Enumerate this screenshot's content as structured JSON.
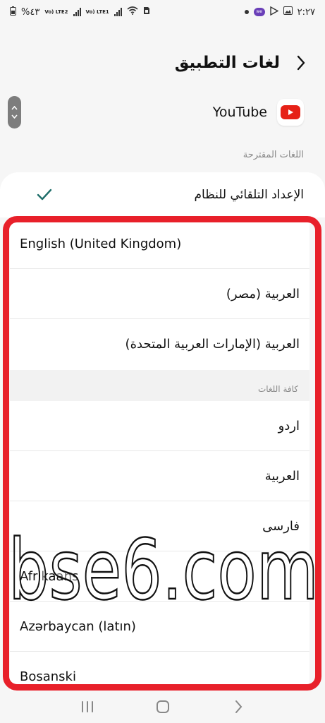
{
  "status_bar": {
    "time": "٢:٢٧",
    "battery": "%٤٣",
    "sim1_label": "Vo) LTE2",
    "sim2_label": "Vo) LTE1"
  },
  "header": {
    "title": "لغات التطبيق"
  },
  "app": {
    "name": "YouTube"
  },
  "sections": {
    "suggested": "اللغات المقترحة",
    "all": "كافة اللغات"
  },
  "system_default": {
    "label": "الإعداد التلقائي للنظام",
    "selected": true
  },
  "suggested_languages": [
    {
      "label": "English (United Kingdom)",
      "dir": "ltr"
    },
    {
      "label": "العربية (مصر)",
      "dir": "rtl"
    },
    {
      "label": "العربية (الإمارات العربية المتحدة)",
      "dir": "rtl"
    }
  ],
  "all_languages": [
    {
      "label": "اردو",
      "dir": "rtl"
    },
    {
      "label": "العربية",
      "dir": "rtl"
    },
    {
      "label": "فارسی",
      "dir": "rtl"
    },
    {
      "label": "Afrikaans",
      "dir": "ltr"
    },
    {
      "label": "Azərbaycan (latın)",
      "dir": "ltr"
    },
    {
      "label": "Bosanski",
      "dir": "ltr"
    }
  ],
  "watermark": {
    "text": "bse6.com"
  },
  "colors": {
    "highlight": "#e8202a",
    "check": "#1f6e6a",
    "youtube_red": "#e62117"
  }
}
